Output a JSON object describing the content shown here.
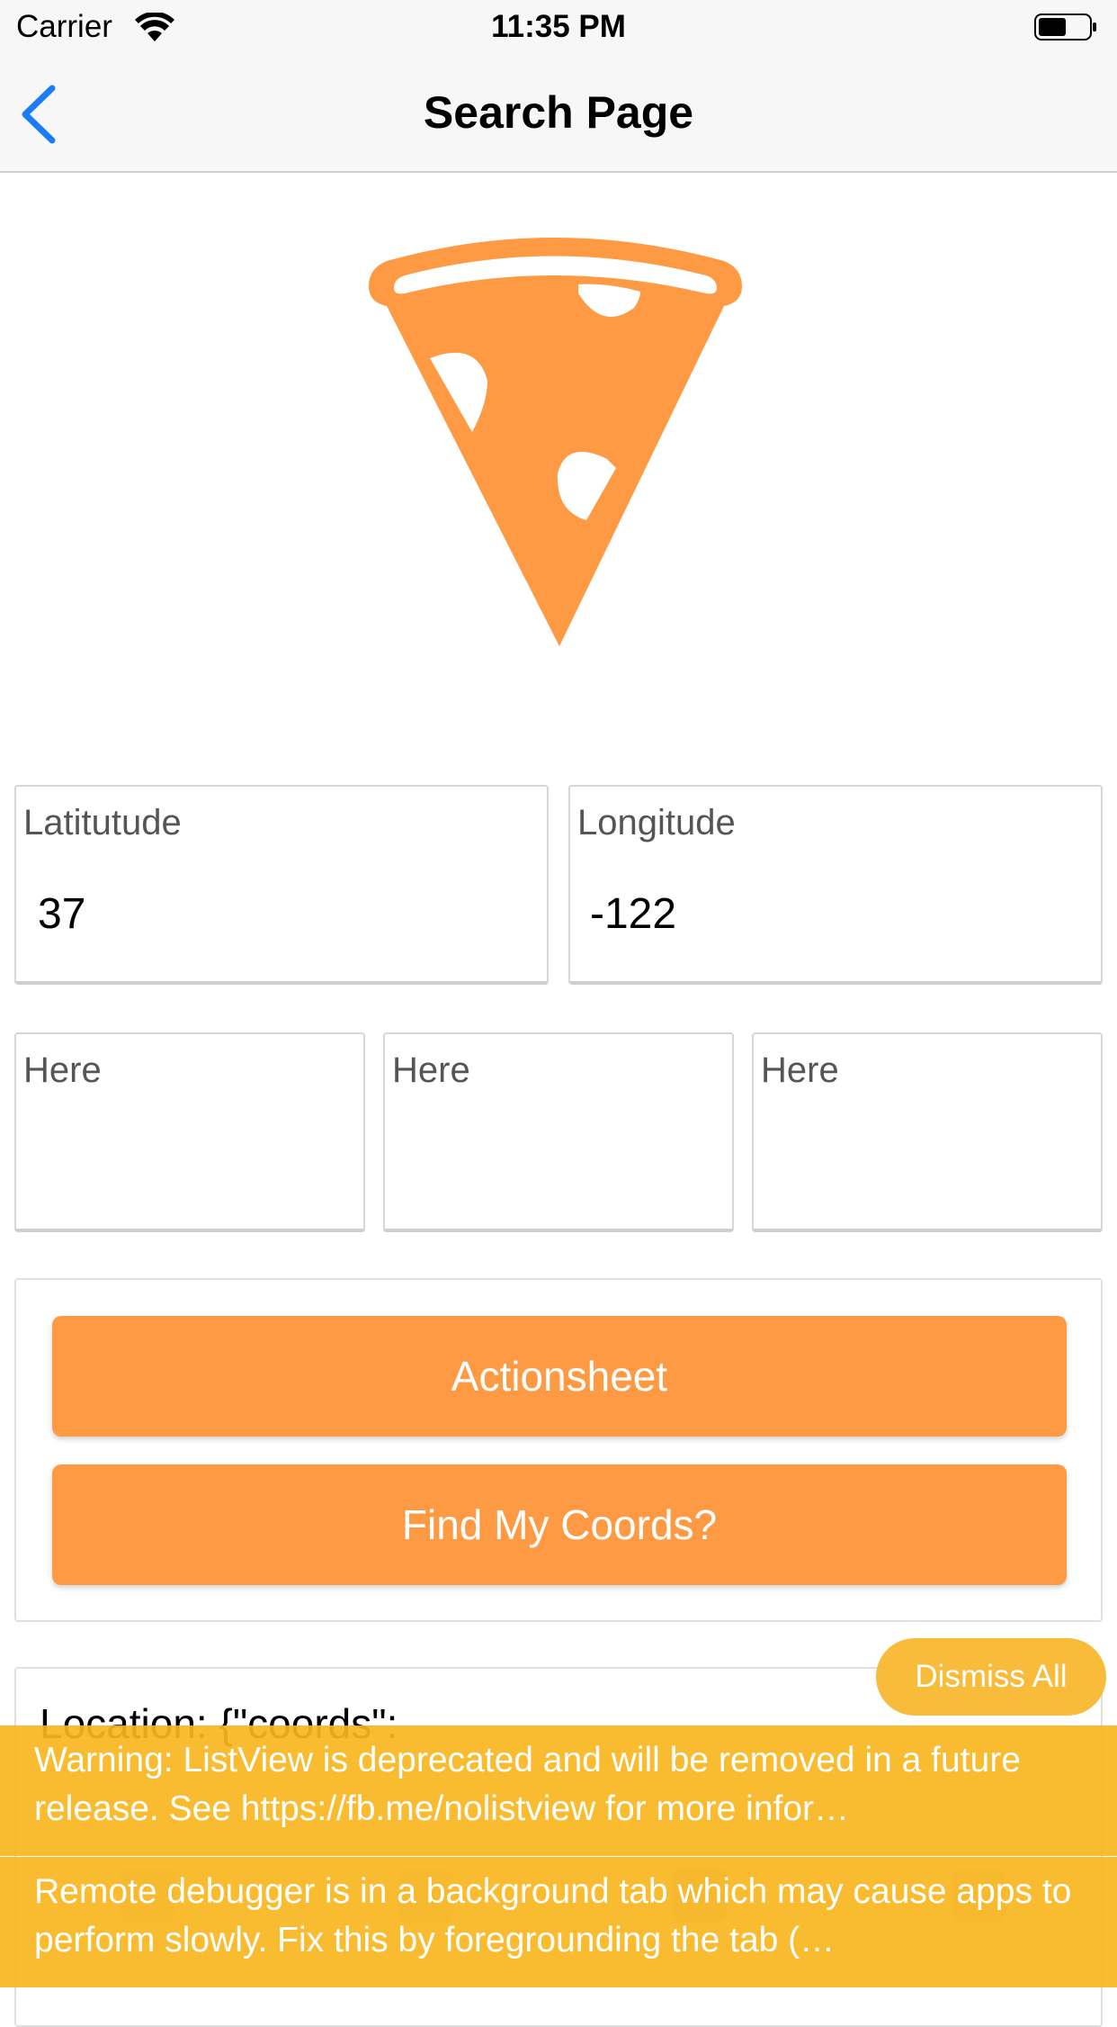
{
  "status_bar": {
    "carrier": "Carrier",
    "time": "11:35 PM"
  },
  "nav": {
    "title": "Search Page"
  },
  "accent_color": "#fe9a43",
  "warning_color": "#f8b620",
  "fields": {
    "latitude": {
      "label": "Latitutude",
      "value": "37"
    },
    "longitude": {
      "label": "Longitude",
      "value": "-122"
    },
    "here_1": {
      "label": "Here"
    },
    "here_2": {
      "label": "Here"
    },
    "here_3": {
      "label": "Here"
    }
  },
  "buttons": {
    "actionsheet": "Actionsheet",
    "find_coords": "Find My Coords?"
  },
  "location": {
    "line1": "Location: {\"coords\":"
  },
  "warnings": {
    "dismiss_all": "Dismiss All",
    "items": [
      {
        "text": "Warning: ListView is deprecated and will be removed in a future release. See https://fb.me/nolistview for more infor…"
      },
      {
        "text": "Remote debugger is in a background tab which may cause apps to perform slowly. Fix this by foregrounding the tab (…"
      }
    ]
  }
}
